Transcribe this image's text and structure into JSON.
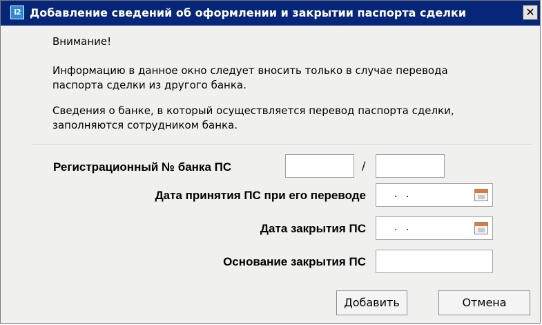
{
  "window": {
    "title": "Добавление сведений об оформлении и закрытии паспорта сделки",
    "icon_text": "i2",
    "close_label": "✕"
  },
  "notice": {
    "heading": "Внимание!",
    "paragraph1_line1": "Информацию в данное окно следует вносить только в случае перевода",
    "paragraph1_line2": "паспорта сделки из другого банка.",
    "paragraph2_line1": "Сведения о банке, в который осуществляется перевод паспорта сделки,",
    "paragraph2_line2": "заполняются сотрудником банка."
  },
  "form": {
    "reg_number_label": "Регистрационный № банка ПС",
    "reg_number_part1": "",
    "reg_number_separator": "/",
    "reg_number_part2": "",
    "accept_date_label": "Дата принятия ПС при его переводе",
    "accept_date_value": ". .",
    "close_date_label": "Дата закрытия ПС",
    "close_date_value": ". .",
    "close_reason_label": "Основание закрытия ПС",
    "close_reason_value": ""
  },
  "buttons": {
    "add_label": "Добавить",
    "cancel_label": "Отмена"
  },
  "icons": {
    "app": "app-i2-icon",
    "close": "close-icon",
    "calendar": "calendar-icon"
  }
}
